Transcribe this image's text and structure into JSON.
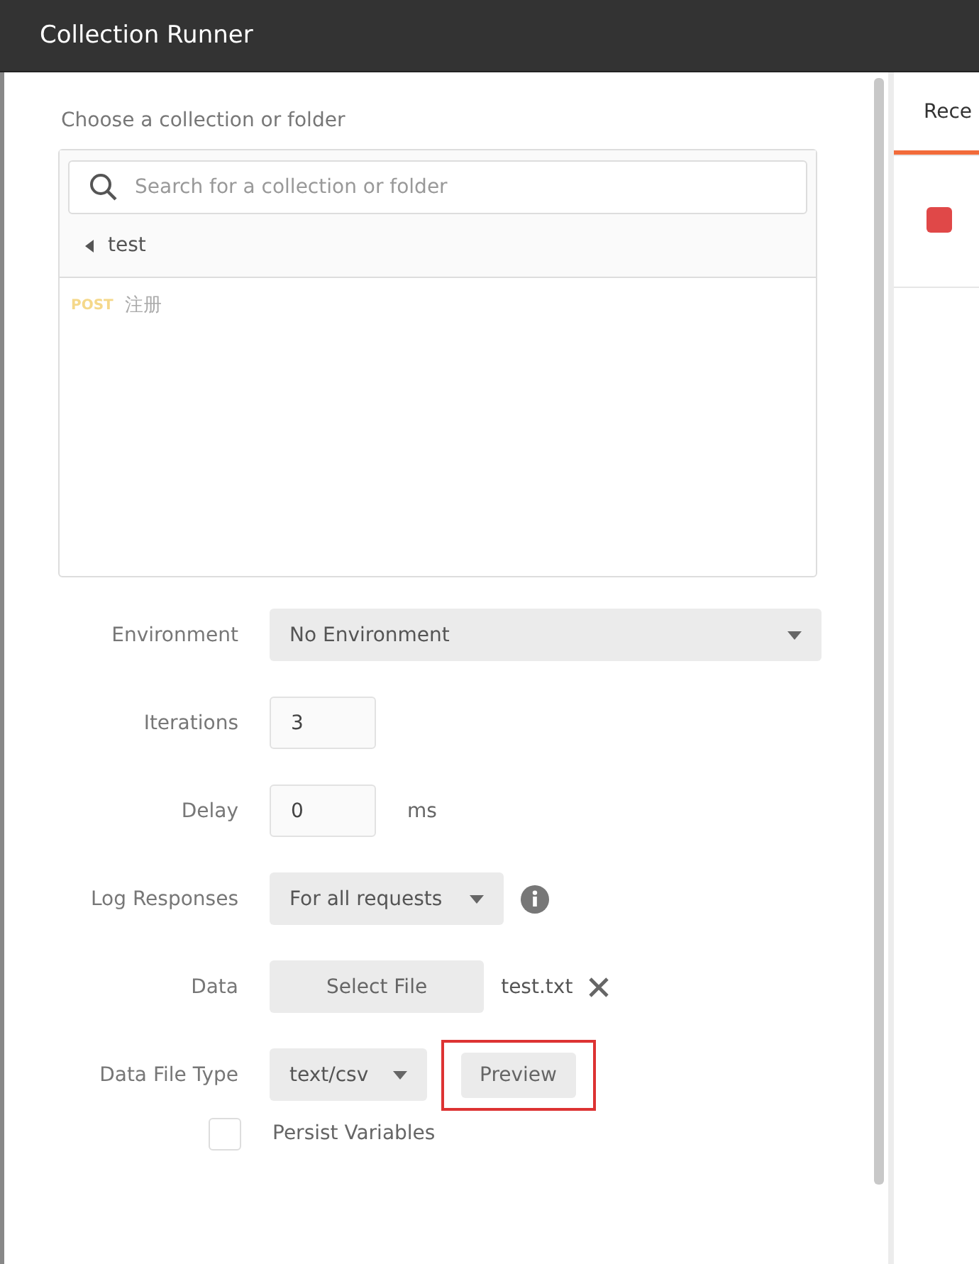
{
  "window": {
    "title": "Collection Runner"
  },
  "chooser": {
    "heading": "Choose a collection or folder",
    "search": {
      "placeholder": "Search for a collection or folder"
    },
    "collection": {
      "name": "test",
      "expanded": true
    },
    "requests": [
      {
        "method": "POST",
        "name": "注册"
      }
    ]
  },
  "form": {
    "environment": {
      "label": "Environment",
      "value": "No Environment"
    },
    "iterations": {
      "label": "Iterations",
      "value": "3"
    },
    "delay": {
      "label": "Delay",
      "value": "0",
      "unit": "ms"
    },
    "log_responses": {
      "label": "Log Responses",
      "value": "For all requests"
    },
    "data": {
      "label": "Data",
      "button": "Select File",
      "file": "test.txt"
    },
    "data_file_type": {
      "label": "Data File Type",
      "value": "text/csv",
      "preview": {
        "label": "Preview",
        "highlighted": true
      }
    },
    "persist_variables": {
      "label": "Persist Variables",
      "checked": false
    }
  },
  "right_panel": {
    "tab": {
      "label": "Rece",
      "selected": true
    }
  }
}
